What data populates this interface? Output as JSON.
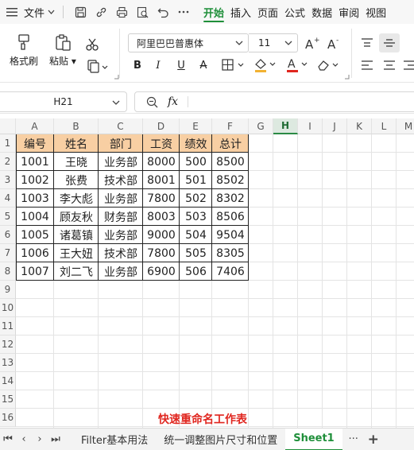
{
  "menubar": {
    "menu_icon": "hamburger-icon",
    "file_label": "文件",
    "tabs": [
      "开始",
      "插入",
      "页面",
      "公式",
      "数据",
      "审阅",
      "视图"
    ],
    "active_tab": "开始"
  },
  "ribbon": {
    "format_painter_label": "格式刷",
    "paste_label": "粘贴",
    "font_name": "阿里巴巴普惠体",
    "font_size": "11",
    "accent_color": "#1f8f3a",
    "fill_color": "#f2b233",
    "font_color": "#e0261f"
  },
  "formula_bar": {
    "cell_ref": "H21",
    "fx_label": "fx",
    "value": ""
  },
  "grid": {
    "columns": [
      "A",
      "B",
      "C",
      "D",
      "E",
      "F",
      "G",
      "H",
      "I",
      "J",
      "K",
      "L",
      "M"
    ],
    "selected_column": "H",
    "rows": [
      "1",
      "2",
      "3",
      "4",
      "5",
      "6",
      "7",
      "8",
      "9",
      "10",
      "11",
      "12",
      "13",
      "14",
      "15",
      "16"
    ],
    "table_header": [
      "编号",
      "姓名",
      "部门",
      "工资",
      "绩效",
      "总计"
    ],
    "table_rows": [
      [
        "1001",
        "王晓",
        "业务部",
        "8000",
        "500",
        "8500"
      ],
      [
        "1002",
        "张费",
        "技术部",
        "8001",
        "501",
        "8502"
      ],
      [
        "1003",
        "李大彪",
        "业务部",
        "7800",
        "502",
        "8302"
      ],
      [
        "1004",
        "顾友秋",
        "财务部",
        "8003",
        "503",
        "8506"
      ],
      [
        "1005",
        "诸葛镇",
        "业务部",
        "9000",
        "504",
        "9504"
      ],
      [
        "1006",
        "王大妞",
        "技术部",
        "7800",
        "505",
        "8305"
      ],
      [
        "1007",
        "刘二飞",
        "业务部",
        "6900",
        "506",
        "7406"
      ]
    ],
    "header_fill": "#f8cfa3"
  },
  "overlay": {
    "caption": "快速重命名工作表",
    "color": "#e0261f"
  },
  "sheets": {
    "tabs": [
      "Filter基本用法",
      "统一调整图片尺寸和位置",
      "Sheet1"
    ],
    "active": "Sheet1",
    "more_label": "···",
    "add_label": "+"
  }
}
